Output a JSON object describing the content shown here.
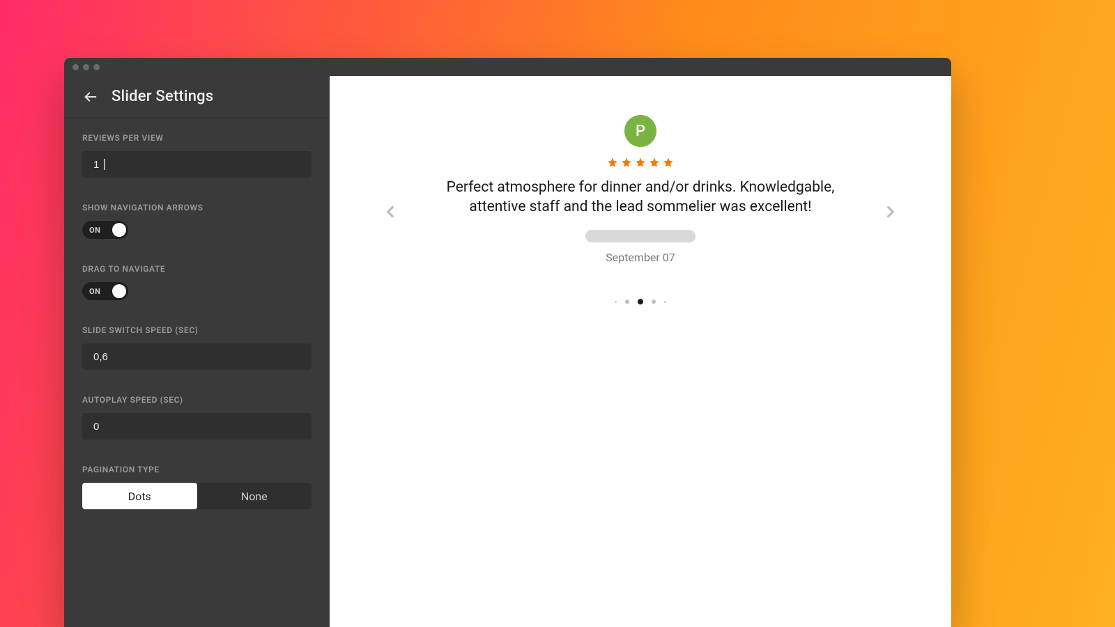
{
  "sidebar": {
    "title": "Slider Settings",
    "reviews_per_view": {
      "label": "REVIEWS PER VIEW",
      "value": "1"
    },
    "show_arrows": {
      "label": "SHOW NAVIGATION ARROWS",
      "state": "ON"
    },
    "drag": {
      "label": "DRAG TO NAVIGATE",
      "state": "ON"
    },
    "speed": {
      "label": "SLIDE SWITCH SPEED (SEC)",
      "value": "0,6"
    },
    "autoplay": {
      "label": "AUTOPLAY SPEED (SEC)",
      "value": "0"
    },
    "pagination": {
      "label": "PAGINATION TYPE",
      "options": [
        "Dots",
        "None"
      ],
      "selected": "Dots"
    }
  },
  "preview": {
    "avatar_initial": "P",
    "rating": 5,
    "text": "Perfect atmosphere for dinner and/or drinks. Knowledgable, attentive staff and the lead sommelier was excellent!",
    "date": "September 07",
    "pagination_dots": 5,
    "active_dot_index": 2
  },
  "colors": {
    "avatar_bg": "#7bb342",
    "star": "#f57c00",
    "sidebar_bg": "#3a3a3a"
  }
}
